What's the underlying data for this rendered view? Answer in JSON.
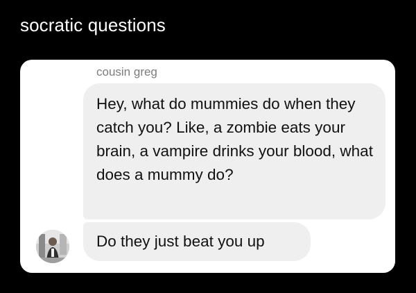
{
  "caption": "socratic questions",
  "chat": {
    "sender_name": "cousin greg",
    "messages": [
      "Hey, what do mummies do when they catch you? Like, a zombie eats your brain, a vampire drinks your blood, what does a mummy do?",
      "Do they just beat you up"
    ],
    "avatar_icon": "user-photo-avatar"
  }
}
